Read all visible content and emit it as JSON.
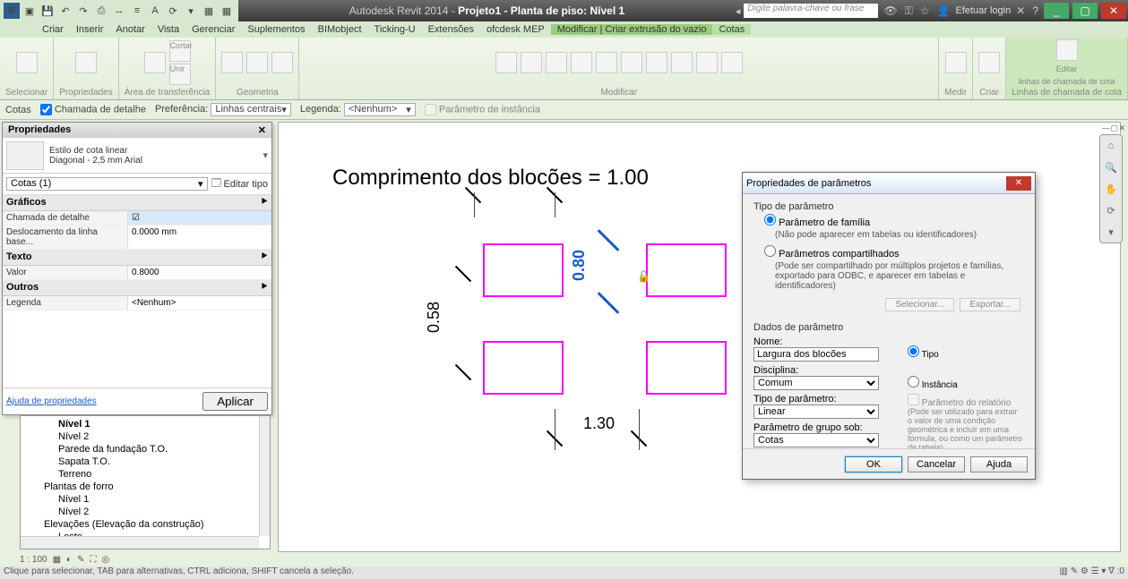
{
  "titlebar": {
    "app_title": "Autodesk Revit 2014 -",
    "doc_title": "Projeto1 - Planta de piso: Nível 1",
    "search_placeholder": "Digite palavra-chave ou frase",
    "login_label": "Efetuar login"
  },
  "menu": {
    "items": [
      "Criar",
      "Inserir",
      "Anotar",
      "Vista",
      "Gerenciar",
      "Suplementos",
      "BIMobject",
      "Ticking-U",
      "Extensões",
      "ofcdesk MEP",
      "Modificar | Criar extrusão do vazio",
      "Cotas"
    ]
  },
  "ribbon": {
    "groups": [
      "Selecionar",
      "Propriedades",
      "Área de transferência",
      "Geometria",
      "Modificar",
      "Medir",
      "Criar",
      "Linhas de chamada de cota"
    ],
    "cortar": "Cortar",
    "unir": "Unir",
    "colar": "Colar",
    "modificar": "Modificar",
    "editar": "Editar",
    "editar_sub": "linhas de chamada de cota"
  },
  "options": {
    "label": "Cotas",
    "chk_label": "Chamada de detalhe",
    "pref_label": "Preferência:",
    "pref_value": "Linhas centrais",
    "legend_label": "Legenda:",
    "legend_value": "<Nenhum>",
    "inst_label": "Parâmetro de instância"
  },
  "props": {
    "title": "Propriedades",
    "type_line1": "Estilo de cota linear",
    "type_line2": "Diagonal - 2,5 mm Arial",
    "sel": "Cotas (1)",
    "edit_type": "Editar tipo",
    "cat_graficos": "Gráficos",
    "k_chamada": "Chamada de detalhe",
    "k_desloc": "Deslocamento da linha base...",
    "v_desloc": "0.0000 mm",
    "cat_texto": "Texto",
    "k_valor": "Valor",
    "v_valor": "0.8000",
    "cat_outros": "Outros",
    "k_legenda": "Legenda",
    "v_legenda": "<Nenhum>",
    "help": "Ajuda de propriedades",
    "apply": "Aplicar"
  },
  "tree": {
    "items": [
      {
        "lvl": "l2 b",
        "t": "Nível 1"
      },
      {
        "lvl": "l2",
        "t": "Nível 2"
      },
      {
        "lvl": "l2",
        "t": "Parede da fundação T.O."
      },
      {
        "lvl": "l2",
        "t": "Sapata T.O."
      },
      {
        "lvl": "l2",
        "t": "Terreno"
      },
      {
        "lvl": "l1",
        "t": "Plantas de forro"
      },
      {
        "lvl": "l2",
        "t": "Nível 1"
      },
      {
        "lvl": "l2",
        "t": "Nível 2"
      },
      {
        "lvl": "l1",
        "t": "Elevações (Elevação da construção)"
      },
      {
        "lvl": "l2",
        "t": "Leste"
      }
    ]
  },
  "viewctl": {
    "scale": "1 : 100"
  },
  "canvas": {
    "title": "Comprimento dos blocões = 1.00",
    "d1": "0.58",
    "d2": "0.80",
    "d3": "1.30"
  },
  "dlg": {
    "title": "Propriedades de parâmetros",
    "g_tipo": "Tipo de parâmetro",
    "r_fam": "Parâmetro de família",
    "r_fam_hint": "(Não pode aparecer em tabelas ou identificadores)",
    "r_comp": "Parâmetros compartilhados",
    "r_comp_hint": "(Pode ser compartilhado por múltiplos projetos e famílias, exportado para ODBC, e aparecer em tabelas e identificadores)",
    "btn_sel": "Selecionar...",
    "btn_exp": "Exportar...",
    "g_dados": "Dados de parâmetro",
    "l_nome": "Nome:",
    "v_nome": "Largura dos blocões",
    "l_disc": "Disciplina:",
    "v_disc": "Comum",
    "l_tipop": "Tipo de parâmetro:",
    "v_tipop": "Linear",
    "l_grupo": "Parâmetro de grupo sob:",
    "v_grupo": "Cotas",
    "r_tipo": "Tipo",
    "r_inst": "Instância",
    "chk_rel": "Parâmetro do relatório",
    "note": "(Pode ser utilizado para extrair o valor de uma condição geométrica e incluir em uma fórmula, ou como um parâmetro de tabela)",
    "ok": "OK",
    "cancel": "Cancelar",
    "help": "Ajuda"
  },
  "status": {
    "left": "Clique para selecionar, TAB para alternativas, CTRL adiciona, SHIFT cancela a seleção."
  }
}
